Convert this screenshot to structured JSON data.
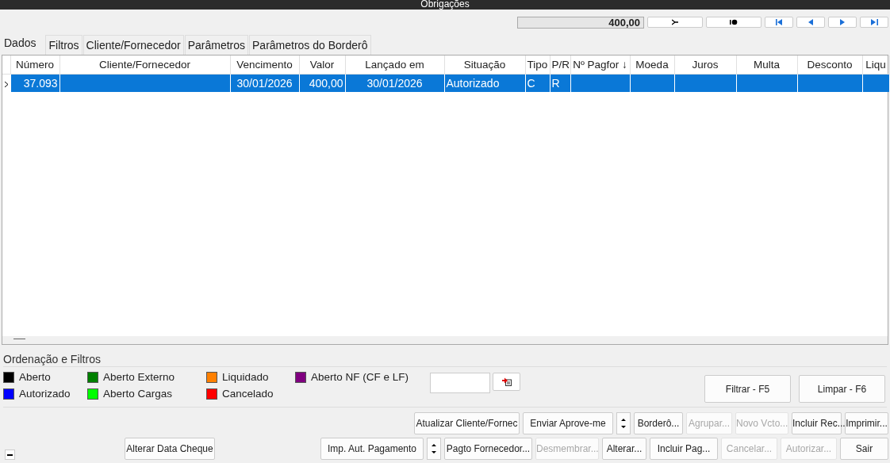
{
  "window": {
    "title": "Obrigações"
  },
  "navigator": {
    "total": "400,00"
  },
  "tabs": [
    {
      "label": "Dados",
      "selected": true
    },
    {
      "label": "Filtros",
      "selected": false
    },
    {
      "label": "Cliente/Fornecedor",
      "selected": false
    },
    {
      "label": "Parâmetros",
      "selected": false
    },
    {
      "label": "Parâmetros do Borderô",
      "selected": false
    }
  ],
  "table": {
    "columns": [
      "Número",
      "Cliente/Fornecedor",
      "Vencimento",
      "Valor",
      "Lançado em",
      "Situação",
      "Tipo",
      "P/R",
      "Nº Pagfor ↓",
      "Moeda",
      "Juros",
      "Multa",
      "Desconto",
      "Liqu"
    ],
    "rows": [
      {
        "selected": true,
        "cells": [
          "37.093",
          "",
          "30/01/2026",
          "400,00",
          "30/01/2026",
          "Autorizado",
          "C",
          "R",
          "",
          "",
          "",
          "",
          "",
          ""
        ]
      }
    ]
  },
  "legend": {
    "title": "Ordenação e Filtros",
    "items": [
      {
        "label": "Aberto",
        "color": "#000000"
      },
      {
        "label": "Autorizado",
        "color": "#0000ff"
      },
      {
        "label": "Aberto Externo",
        "color": "#008000"
      },
      {
        "label": "Aberto Cargas",
        "color": "#00ff00"
      },
      {
        "label": "Liquidado",
        "color": "#ff8000"
      },
      {
        "label": "Cancelado",
        "color": "#ff0000"
      },
      {
        "label": "Aberto NF (CF e LF)",
        "color": "#800080"
      }
    ]
  },
  "filter_buttons": [
    "Filtrar - F5",
    "Limpar - F6"
  ],
  "action_row_1": [
    {
      "kind": "button",
      "label": "Atualizar Cliente/Fornec",
      "disabled": false
    },
    {
      "kind": "button",
      "label": "Enviar Aprove-me",
      "disabled": false
    },
    {
      "kind": "spinner"
    },
    {
      "kind": "button",
      "label": "Borderô...",
      "disabled": false
    },
    {
      "kind": "button",
      "label": "Agrupar...",
      "disabled": true
    },
    {
      "kind": "button",
      "label": "Novo Vcto...",
      "disabled": true
    },
    {
      "kind": "button",
      "label": "Incluir Rec...",
      "disabled": false
    },
    {
      "kind": "button",
      "label": "Imprimir...",
      "disabled": false
    }
  ],
  "left_button": "Alterar Data Cheque",
  "action_row_2": [
    {
      "kind": "button",
      "label": "Imp. Aut. Pagamento",
      "disabled": false
    },
    {
      "kind": "spinner"
    },
    {
      "kind": "button",
      "label": "Pagto Fornecedor...",
      "disabled": false
    },
    {
      "kind": "button",
      "label": "Desmembrar...",
      "disabled": true
    },
    {
      "kind": "button",
      "label": "Alterar...",
      "disabled": false
    },
    {
      "kind": "button",
      "label": "Incluir Pag...",
      "disabled": false
    },
    {
      "kind": "button",
      "label": "Cancelar...",
      "disabled": true
    },
    {
      "kind": "button",
      "label": "Autorizar...",
      "disabled": true
    },
    {
      "kind": "button",
      "label": "Sair",
      "disabled": false
    }
  ]
}
